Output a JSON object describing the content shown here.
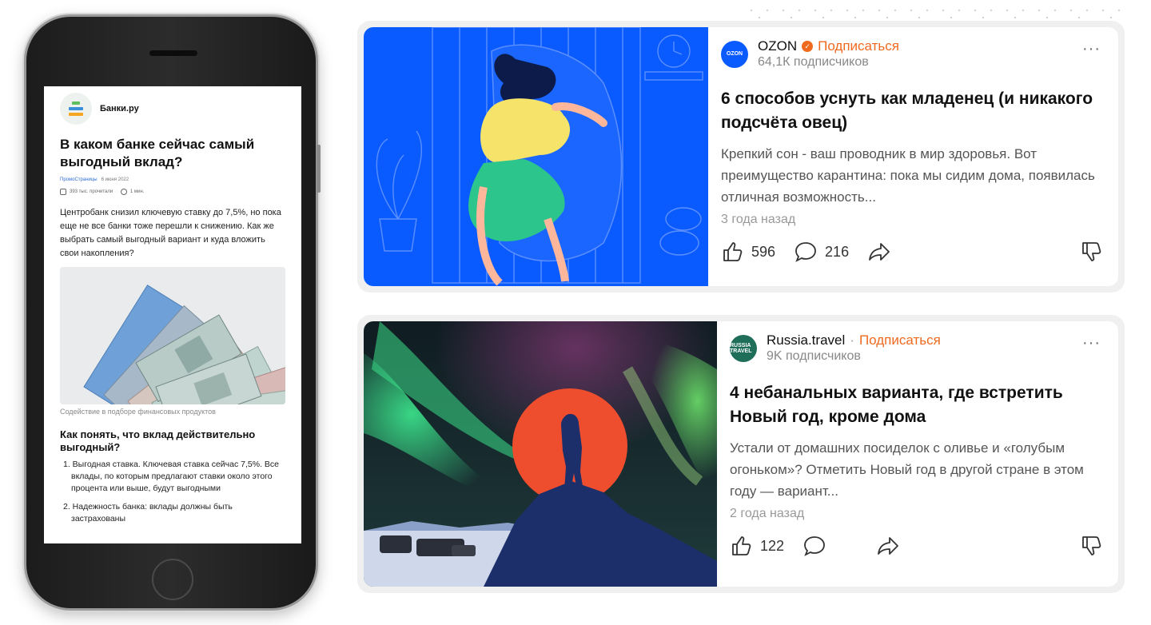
{
  "phone": {
    "channel_name": "Банки.ру",
    "title": "В каком банке сейчас самый выгодный вклад?",
    "meta_source": "ПромоСтраницы",
    "meta_date": "6 июня 2022",
    "meta_views": "393 тыс. прочитали",
    "meta_read_time": "1 мин.",
    "lead": "Центробанк снизил ключевую ставку до 7,5%, но пока еще не все банки тоже перешли к снижению. Как же выбрать самый выгодный вариант и куда вложить свои накопления?",
    "caption": "Содействие в подборе финансовых продуктов",
    "h2": "Как понять, что вклад действительно выгодный?",
    "list": [
      "1. Выгодная ставка. Ключевая ставка сейчас 7,5%. Все вклады, по которым предлагают ставки около этого процента или выше, будут выгодными",
      "2. Надежность банка: вклады должны быть застрахованы"
    ]
  },
  "cards": [
    {
      "channel": "OZON",
      "logo_text": "OZON",
      "subscribe_label": "Подписаться",
      "subscribers": "64,1К подписчиков",
      "title": "6 способов уснуть как младенец (и никакого подсчёта овец)",
      "description": "Крепкий сон - ваш проводник в мир здоровья. Вот преимущество карантина: пока мы сидим дома, появилась отличная возможность...",
      "age": "3 года назад",
      "likes": "596",
      "comments": "216",
      "more": "···",
      "icons": [
        "like-icon",
        "comment-icon",
        "share-icon",
        "dislike-icon"
      ]
    },
    {
      "channel": "Russia.travel",
      "logo_text": "RUSSIA TRAVEL",
      "separator": "·",
      "subscribe_label": "Подписаться",
      "subscribers": "9K подписчиков",
      "title": "4 небанальных варианта, где встретить Новый год, кроме дома",
      "description": "Устали от домашних посиделок с оливье и «голубым огоньком»? Отметить Новый год в другой стране в этом году — вариант...",
      "age": "2 года назад",
      "likes": "122",
      "comments": "",
      "more": "···",
      "icons": [
        "like-icon",
        "comment-icon",
        "share-icon",
        "dislike-icon"
      ]
    }
  ],
  "colors": {
    "accent": "#ef6a1f",
    "ozon_blue": "#0a5bff",
    "russia_travel_green": "#1f6e5a",
    "aurora_green": "#3be08a",
    "sun_red": "#ef4e2e",
    "night_navy": "#1c2f6b"
  }
}
